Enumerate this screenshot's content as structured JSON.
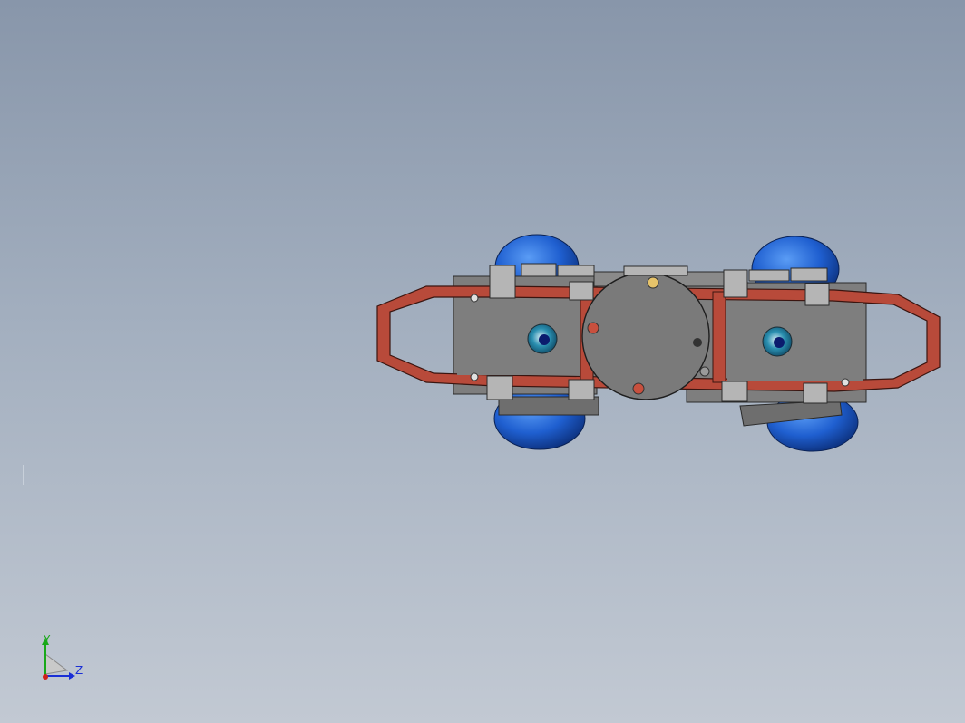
{
  "viewport": {
    "background_top": "#8896aa",
    "background_bottom": "#c2c9d3"
  },
  "model": {
    "frame_color": "#b84a3a",
    "plate_color": "#7e7e7e",
    "wheel_color": "#1f5fd0",
    "hub_color": "#2a8fb0",
    "bracket_color": "#b5b5b5"
  },
  "triad": {
    "y_label": "Y",
    "z_label": "Z",
    "y_color": "#18a818",
    "z_color": "#1a2fd6",
    "x_color": "#d0201a"
  }
}
